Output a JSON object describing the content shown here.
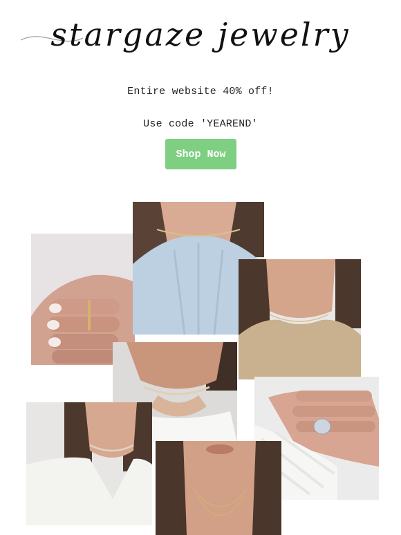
{
  "brand": {
    "name": "stargaze jewelry"
  },
  "promo": {
    "line1": "Entire website 40% off!",
    "line2": "Use code 'YEAREND'"
  },
  "cta": {
    "label": "Shop Now",
    "color": "#7fcf82"
  },
  "gallery": {
    "photos": [
      {
        "id": "ring-hand",
        "subject": "hand wearing thin gold ring"
      },
      {
        "id": "halter-choker",
        "subject": "choker with light blue halter top"
      },
      {
        "id": "sweater-necklace",
        "subject": "fine chain on beige sweater"
      },
      {
        "id": "white-tank-choker",
        "subject": "opal choker with white tank"
      },
      {
        "id": "heart-ring",
        "subject": "heart ring on hand with knit sleeve"
      },
      {
        "id": "white-sweater-choker",
        "subject": "choker with white fuzzy sweater"
      },
      {
        "id": "layered-necklace",
        "subject": "long layered necklace"
      }
    ]
  }
}
